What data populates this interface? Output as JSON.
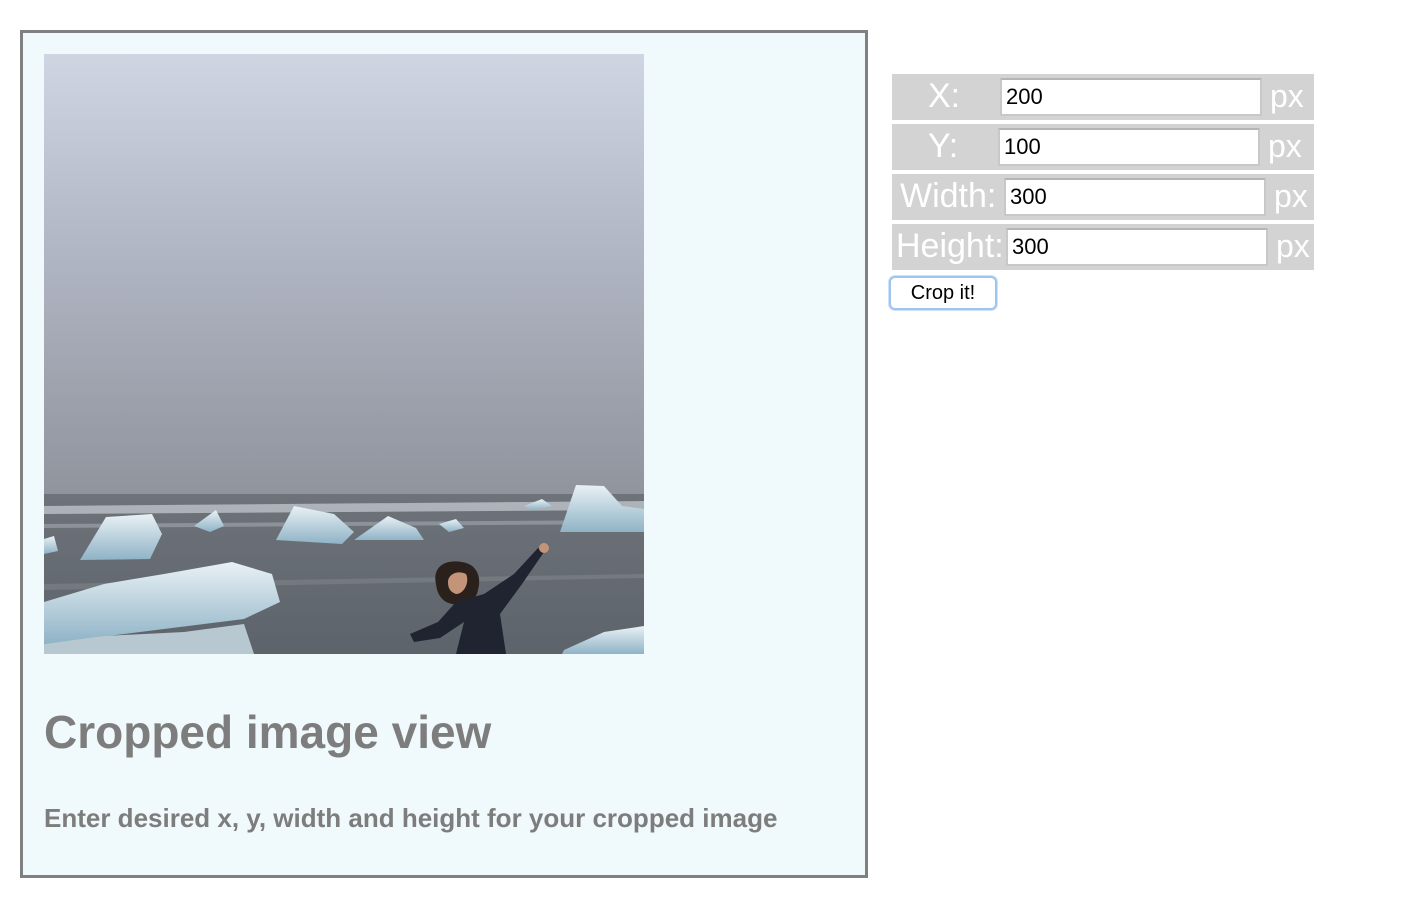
{
  "preview": {
    "image_alt": "Cropped photo: person posing on a black-sand beach with icebergs under a grey sky",
    "title": "Cropped image view",
    "subtitle": "Enter desired x, y, width and height for your cropped image"
  },
  "form": {
    "fields": [
      {
        "label": "X:",
        "value": "200",
        "unit": "px"
      },
      {
        "label": "Y:",
        "value": "100",
        "unit": "px"
      },
      {
        "label": "Width:",
        "value": "300",
        "unit": "px"
      },
      {
        "label": "Height:",
        "value": "300",
        "unit": "px"
      }
    ],
    "crop_button": "Crop it!"
  },
  "colors": {
    "card_background": "#f0f9fc",
    "card_border": "#808080",
    "field_row_background": "#d3d3d3",
    "button_focus": "#9ec5ee"
  }
}
